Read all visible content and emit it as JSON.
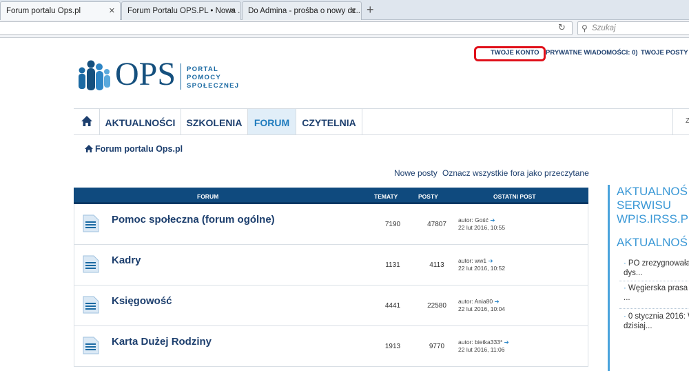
{
  "browser": {
    "tabs": [
      {
        "label": "Forum portalu Ops.pl",
        "active": true
      },
      {
        "label": "Forum Portalu OPS.PL • Nowa ...",
        "active": false
      },
      {
        "label": "Do Admina - prośba o nowy dz...",
        "active": false
      }
    ],
    "new_tab": "+",
    "search_placeholder": "Szukaj"
  },
  "header": {
    "links": [
      {
        "label": "TWOJE KONTO"
      },
      {
        "label": "PRYWATNE WIADOMOŚCI: 0)"
      },
      {
        "label": "TWOJE POSTY"
      }
    ],
    "logo": {
      "text": "OPS",
      "sub": [
        "PORTAL",
        "POMOCY",
        "SPOŁECZNEJ"
      ]
    }
  },
  "nav": {
    "items": [
      {
        "label": "AKTUALNOŚCI"
      },
      {
        "label": "SZKOLENIA"
      },
      {
        "label": "FORUM",
        "active": true
      },
      {
        "label": "CZYTELNIA"
      }
    ],
    "right_text": "Z"
  },
  "breadcrumb": "Forum portalu Ops.pl",
  "actions": {
    "new_posts": "Nowe posty",
    "mark_read": "Oznacz wszystkie fora jako przeczytane"
  },
  "table": {
    "headers": {
      "forum": "FORUM",
      "topics": "TEMATY",
      "posts": "POSTY",
      "last": "OSTATNI POST"
    },
    "rows": [
      {
        "name": "Pomoc społeczna (forum ogólne)",
        "topics": "7190",
        "posts": "47807",
        "author": "autor: Gość",
        "date": "22 lut 2016, 10:55"
      },
      {
        "name": "Kadry",
        "topics": "1131",
        "posts": "4113",
        "author": "autor: ww1",
        "date": "22 lut 2016, 10:52"
      },
      {
        "name": "Księgowość",
        "topics": "4441",
        "posts": "22580",
        "author": "autor: Ania80",
        "date": "22 lut 2016, 10:04"
      },
      {
        "name": "Karta Dużej Rodziny",
        "topics": "1913",
        "posts": "9770",
        "author": "autor: bietka333*",
        "date": "22 lut 2016, 11:06"
      }
    ]
  },
  "sidebar": {
    "heading1": [
      "AKTUALNOŚ",
      "SERWISU",
      "WPIS.IRSS.P"
    ],
    "heading2": "AKTUALNOŚ",
    "items": [
      {
        "line1": "PO zrezygnowała",
        "line2": "dys..."
      },
      {
        "line1": "Węgierska prasa",
        "line2": "..."
      },
      {
        "line1": "0 stycznia 2016: W",
        "line2": "dzisiaj..."
      }
    ]
  },
  "colors": {
    "brand": "#15507e",
    "accent": "#3a98d6",
    "table_head": "#0f4a7e",
    "highlight": "#e0101a"
  }
}
